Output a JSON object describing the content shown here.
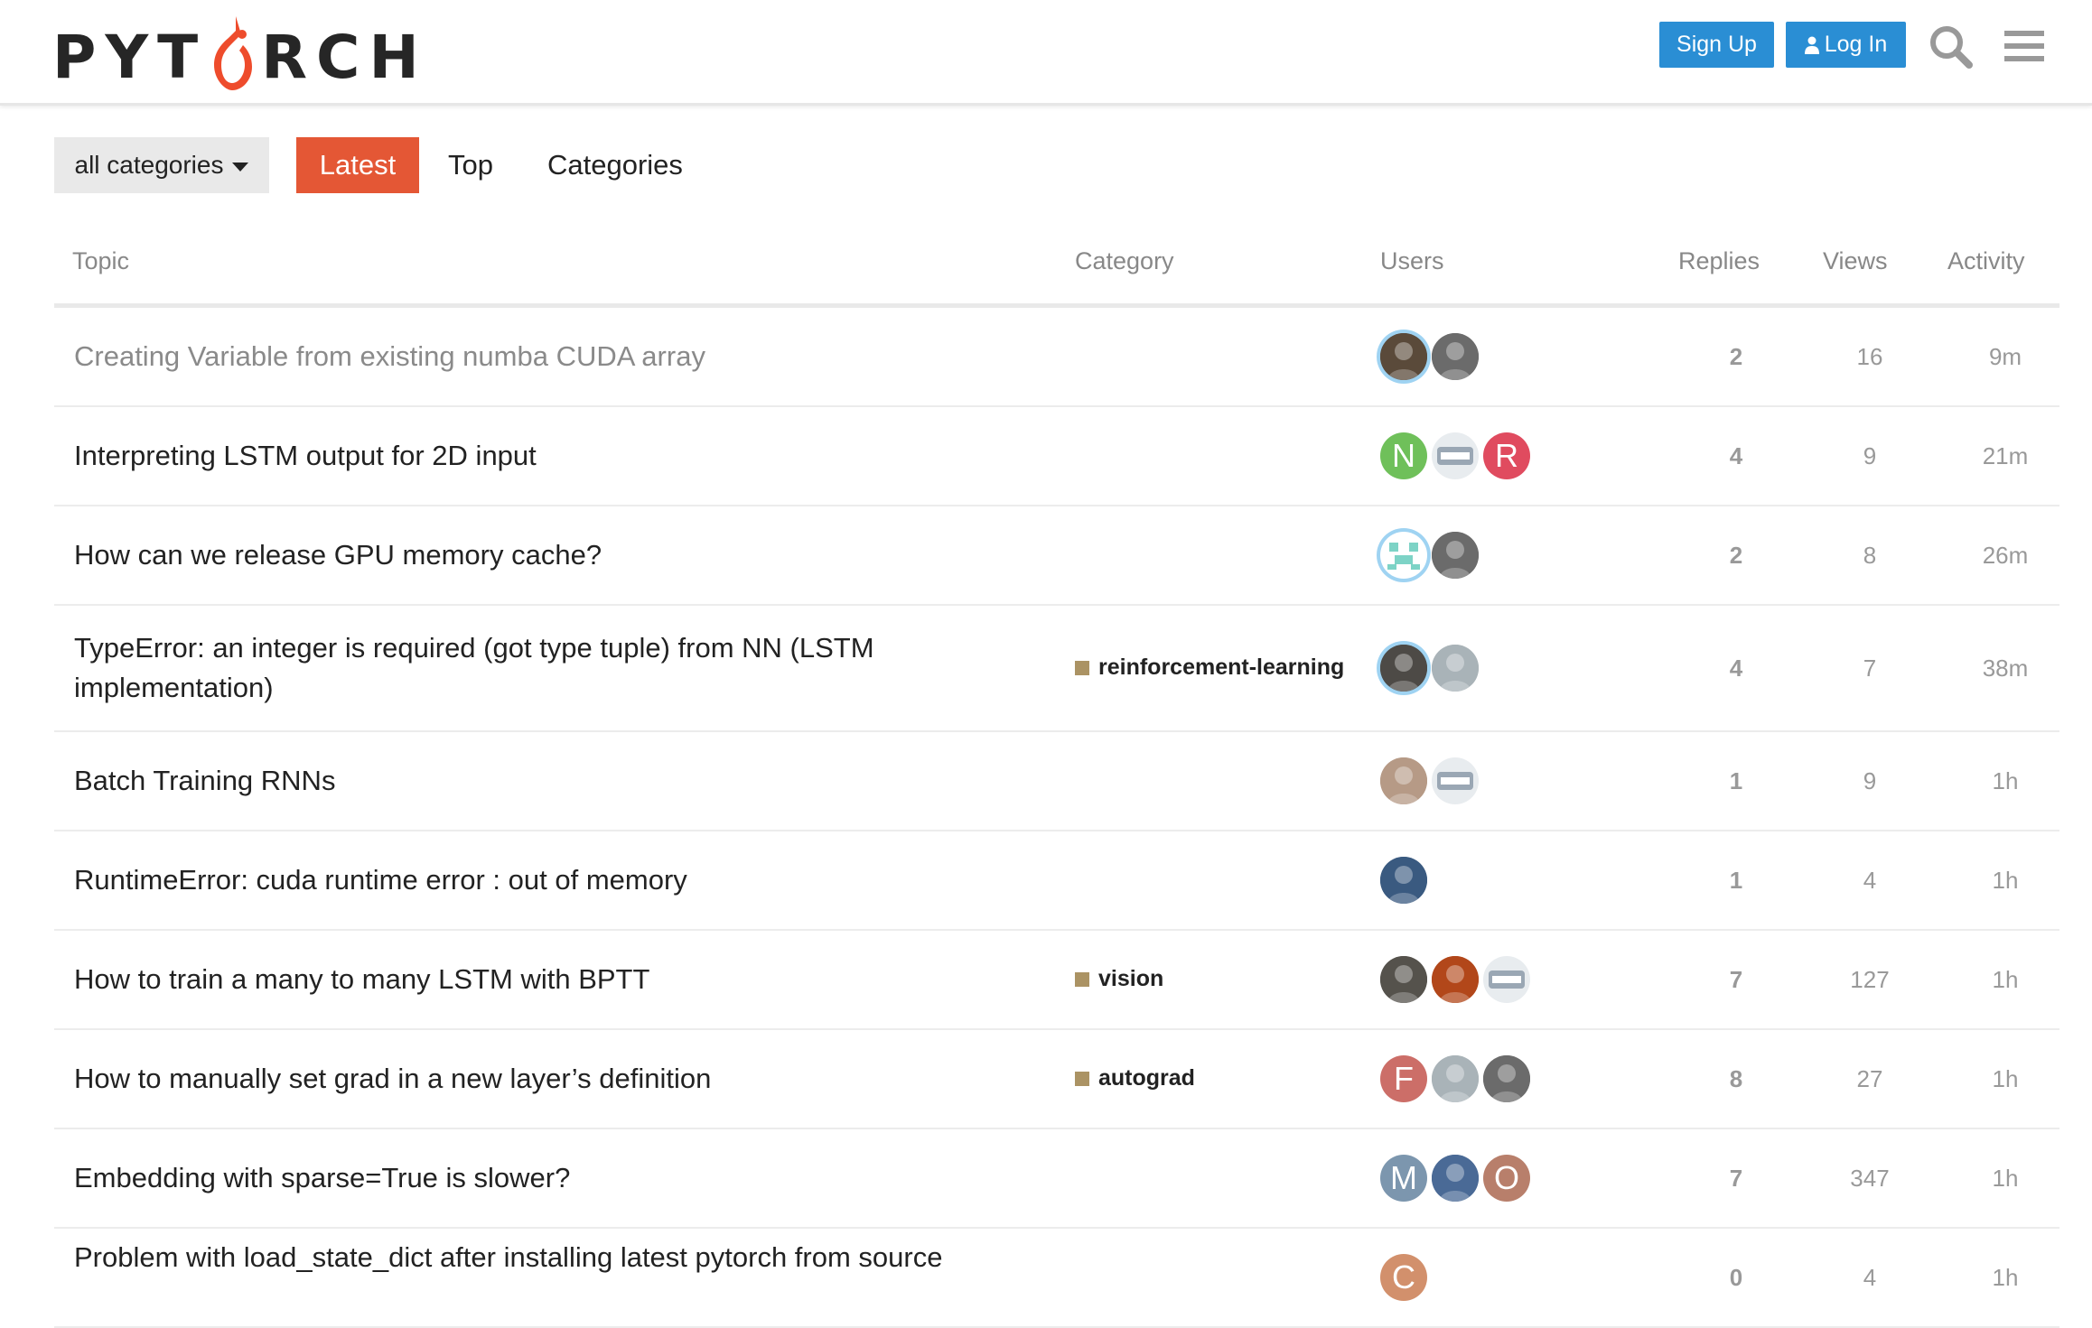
{
  "header": {
    "logo_prefix": "PYT",
    "logo_suffix": "RCH",
    "sign_up_label": "Sign Up",
    "log_in_label": "Log In",
    "icons": [
      "search-icon",
      "hamburger-menu-icon",
      "user-icon"
    ]
  },
  "nav": {
    "category_dropdown": "all categories",
    "tabs": [
      {
        "label": "Latest",
        "active": true
      },
      {
        "label": "Top",
        "active": false
      },
      {
        "label": "Categories",
        "active": false
      }
    ]
  },
  "table": {
    "columns": {
      "topic": "Topic",
      "category": "Category",
      "users": "Users",
      "replies": "Replies",
      "views": "Views",
      "activity": "Activity"
    },
    "rows": [
      {
        "title": "Creating Variable from existing numba CUDA array",
        "category": "",
        "replies": "2",
        "views": "16",
        "activity": "9m",
        "users": [
          {
            "type": "photo",
            "color": "#5a4a3a"
          },
          {
            "type": "photo",
            "color": "#6b6b6b"
          }
        ]
      },
      {
        "title": "Interpreting LSTM output for 2D input",
        "category": "",
        "replies": "4",
        "views": "9",
        "activity": "21m",
        "users": [
          {
            "type": "letter",
            "letter": "N",
            "color": "#6fc05a"
          },
          {
            "type": "sticker",
            "color": "#9aa7b4"
          },
          {
            "type": "letter",
            "letter": "R",
            "color": "#e04b5f"
          }
        ]
      },
      {
        "title": "How can we release GPU memory cache?",
        "category": "",
        "replies": "2",
        "views": "8",
        "activity": "26m",
        "users": [
          {
            "type": "identicon",
            "color": "#7dd3c6"
          },
          {
            "type": "photo",
            "color": "#6b6b6b"
          }
        ]
      },
      {
        "title": "TypeError: an integer is required (got type tuple) from NN (LSTM implementation)",
        "category": "reinforcement-learning",
        "replies": "4",
        "views": "7",
        "activity": "38m",
        "users": [
          {
            "type": "photo",
            "color": "#4d4a46"
          },
          {
            "type": "photo",
            "color": "#a9b3b8"
          }
        ]
      },
      {
        "title": "Batch Training RNNs",
        "category": "",
        "replies": "1",
        "views": "9",
        "activity": "1h",
        "users": [
          {
            "type": "photo",
            "color": "#b69a86"
          },
          {
            "type": "sticker",
            "color": "#9aa7b4"
          }
        ]
      },
      {
        "title": "RuntimeError: cuda runtime error : out of memory",
        "category": "",
        "replies": "1",
        "views": "4",
        "activity": "1h",
        "users": [
          {
            "type": "photo",
            "color": "#3a5a80"
          }
        ]
      },
      {
        "title": "How to train a many to many LSTM with BPTT",
        "category": "vision",
        "replies": "7",
        "views": "127",
        "activity": "1h",
        "users": [
          {
            "type": "photo",
            "color": "#55524c"
          },
          {
            "type": "photo",
            "color": "#b2471a"
          },
          {
            "type": "sticker",
            "color": "#9aa7b4"
          }
        ]
      },
      {
        "title": "How to manually set grad in a new layer’s definition",
        "category": "autograd",
        "replies": "8",
        "views": "27",
        "activity": "1h",
        "users": [
          {
            "type": "letter",
            "letter": "F",
            "color": "#cc6e68"
          },
          {
            "type": "photo",
            "color": "#a9b3b8"
          },
          {
            "type": "photo",
            "color": "#6b6b6b"
          }
        ]
      },
      {
        "title": "Embedding with sparse=True is slower?",
        "category": "",
        "replies": "7",
        "views": "347",
        "activity": "1h",
        "users": [
          {
            "type": "letter",
            "letter": "M",
            "color": "#7c96ae"
          },
          {
            "type": "photo",
            "color": "#4a6a96"
          },
          {
            "type": "letter",
            "letter": "O",
            "color": "#b87f6b"
          }
        ]
      },
      {
        "title": "Problem with load_state_dict after installing latest pytorch from source",
        "category": "",
        "replies": "0",
        "views": "4",
        "activity": "1h",
        "users": [
          {
            "type": "letter",
            "letter": "C",
            "color": "#d2906c"
          }
        ]
      }
    ]
  }
}
